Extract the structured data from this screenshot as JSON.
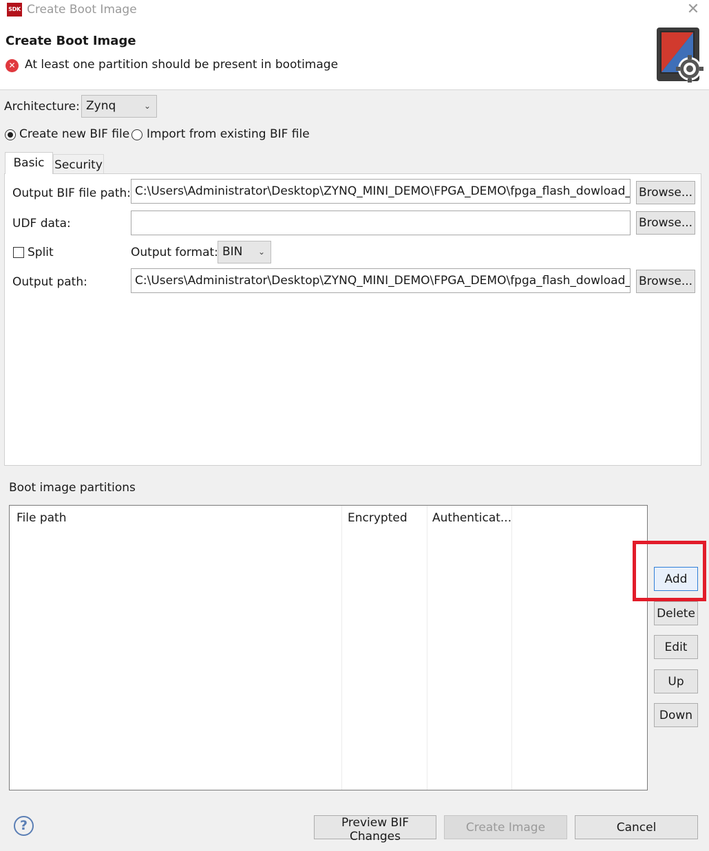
{
  "window": {
    "logo_text": "SDK",
    "title": "Create Boot Image",
    "close_glyph": "✕"
  },
  "header": {
    "title": "Create Boot Image",
    "error_message": "At least one partition should be present in bootimage",
    "error_icon": "error-icon",
    "graphic_icon": "boot-image-gear-icon"
  },
  "architecture": {
    "label": "Architecture:",
    "selected": "Zynq"
  },
  "bif_source": {
    "option_new": "Create new BIF file",
    "option_import": "Import from existing BIF file",
    "selected": "Create new BIF file"
  },
  "tabs": [
    {
      "label": "Basic",
      "active": true
    },
    {
      "label": "Security",
      "active": false
    }
  ],
  "basic": {
    "output_bif_label": "Output BIF file path:",
    "output_bif_value": "C:\\Users\\Administrator\\Desktop\\ZYNQ_MINI_DEMO\\FPGA_DEMO\\fpga_flash_dowload_pr",
    "udf_label": "UDF data:",
    "udf_value": "",
    "split_label": "Split",
    "split_checked": false,
    "output_format_label": "Output format:",
    "output_format_value": "BIN",
    "output_path_label": "Output path:",
    "output_path_value": "C:\\Users\\Administrator\\Desktop\\ZYNQ_MINI_DEMO\\FPGA_DEMO\\fpga_flash_dowload_pr",
    "browse_label": "Browse..."
  },
  "partitions": {
    "title": "Boot image partitions",
    "columns": [
      "File path",
      "Encrypted",
      "Authenticat..."
    ],
    "rows": [],
    "buttons": {
      "add": "Add",
      "delete": "Delete",
      "edit": "Edit",
      "up": "Up",
      "down": "Down"
    }
  },
  "footer": {
    "help_glyph": "?",
    "preview": "Preview BIF Changes",
    "create": "Create Image",
    "cancel": "Cancel"
  },
  "colors": {
    "highlight": "#e21c2a",
    "focus": "#2f7fd8",
    "error": "#e0383e"
  }
}
